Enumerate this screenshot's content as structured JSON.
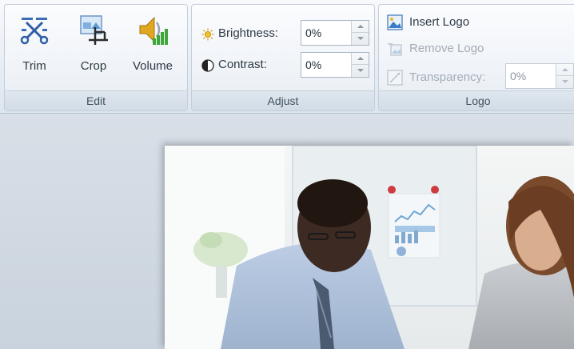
{
  "ribbon": {
    "edit": {
      "label": "Edit",
      "buttons": [
        {
          "label": "Trim",
          "icon": "scissors-icon"
        },
        {
          "label": "Crop",
          "icon": "crop-icon"
        },
        {
          "label": "Volume",
          "icon": "volume-icon"
        }
      ]
    },
    "adjust": {
      "label": "Adjust",
      "brightness": {
        "label": "Brightness:",
        "value": "0%",
        "icon": "sun-icon"
      },
      "contrast": {
        "label": "Contrast:",
        "value": "0%",
        "icon": "contrast-icon"
      }
    },
    "logo": {
      "label": "Logo",
      "insert": {
        "label": "Insert Logo",
        "icon": "insert-logo-icon",
        "enabled": true
      },
      "remove": {
        "label": "Remove Logo",
        "icon": "remove-logo-icon",
        "enabled": false
      },
      "transparency": {
        "label": "Transparency:",
        "value": "0%",
        "icon": "transparency-icon",
        "enabled": false
      }
    }
  },
  "colors": {
    "ribbon_bg": "#e9eef5",
    "workarea_bg": "#d2dae3",
    "disabled_text": "#a3acb6"
  }
}
